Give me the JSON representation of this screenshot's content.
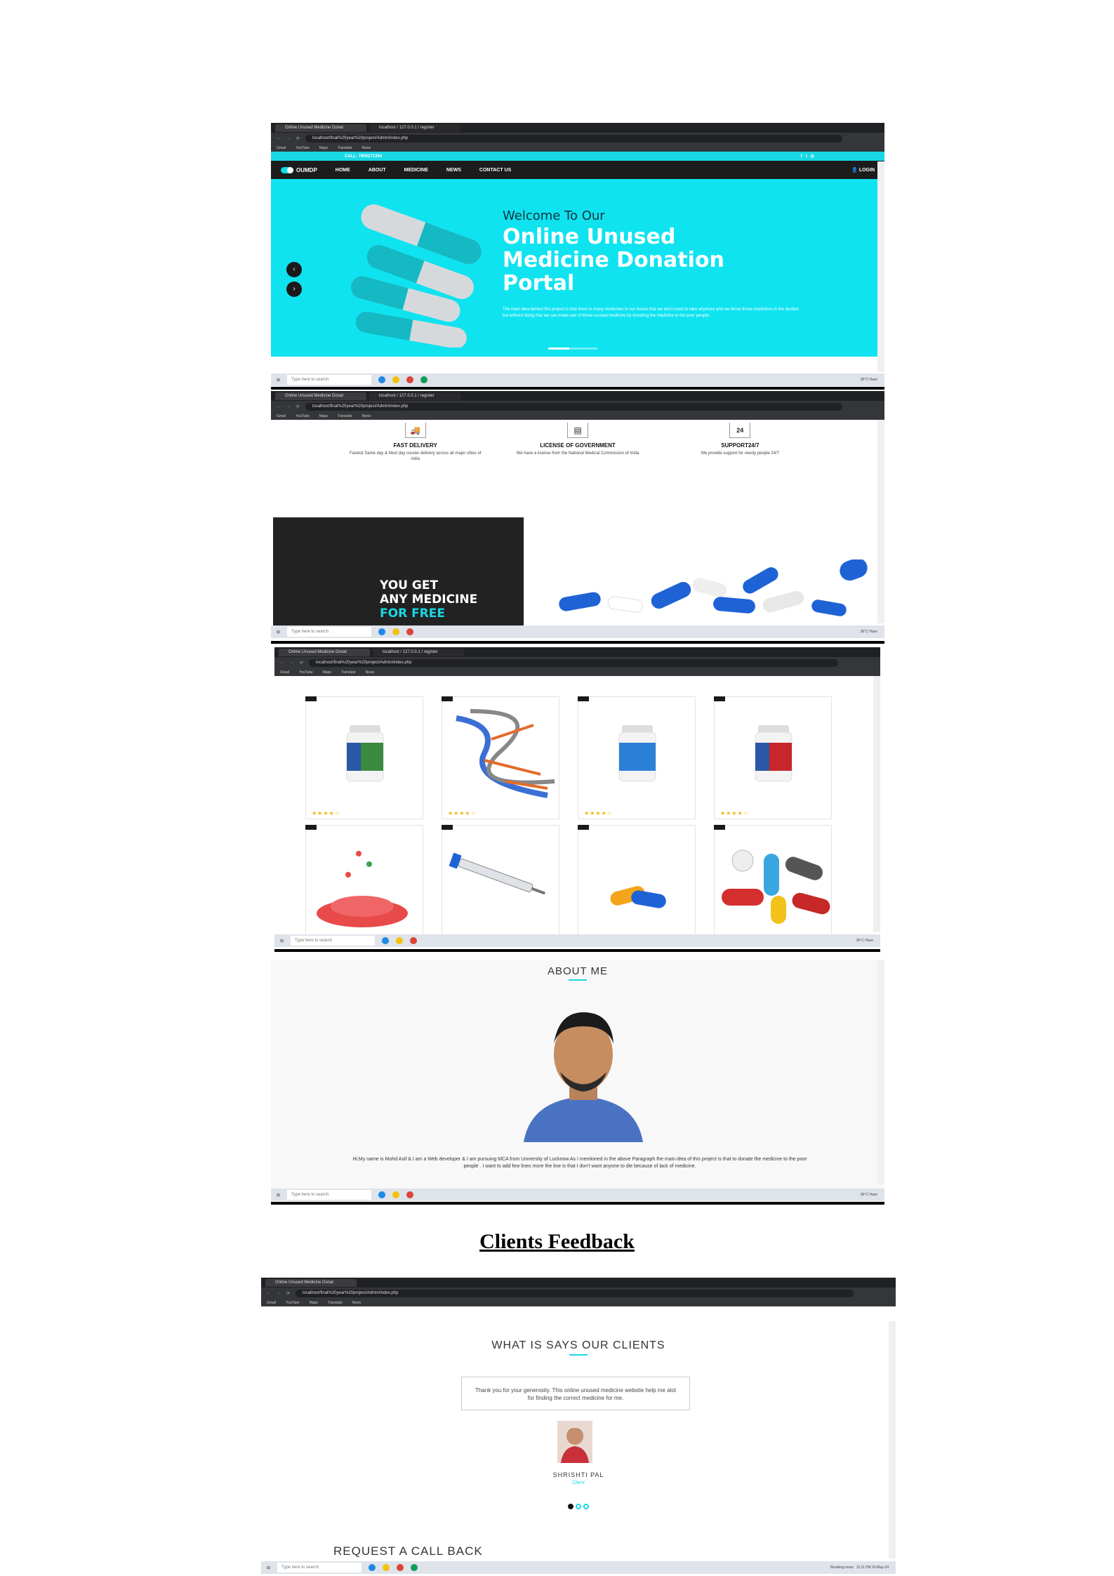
{
  "browser": {
    "tab_active": "Online Unused Medicine Donat",
    "tab_second": "localhost / 127.0.0.1 / register",
    "url": "localhost/final%20year%20project/Admin/index.php",
    "bookmarks": [
      "Gmail",
      "YouTube",
      "Maps",
      "Translate",
      "News"
    ]
  },
  "taskbar": {
    "search_placeholder": "Type here to search",
    "weather": "36°C Haze",
    "weather_last": "Breaking news",
    "time": "11:11 PM",
    "date": "15-May-24"
  },
  "site": {
    "call": "CALL: 7900271384",
    "brand": "OUMDP",
    "nav": [
      "HOME",
      "ABOUT",
      "MEDICINE",
      "NEWS",
      "CONTACT US"
    ],
    "login": "LOGIN",
    "hero_small": "Welcome To Our",
    "hero_big": "Online Unused Medicine Donation Portal",
    "hero_text": "The main idea behind this project is that there is many medicines in our house that we don't need to take anymore and we throw those medicines in the dustbin but without doing that we can make use of those unused medicine by donating the medicine to the poor people."
  },
  "features": [
    {
      "title": "FAST DELIVERY",
      "text": "Fastest Same day & Next day courier delivery across all major cities of india",
      "icon": "truck-icon"
    },
    {
      "title": "LICENSE OF GOVERNMENT",
      "text": "We have a license from the National Medical Commission of India",
      "icon": "license-icon"
    },
    {
      "title": "SUPPORT24/7",
      "text": "We provide support for needy people 24/7",
      "icon": "24-hours-icon"
    }
  ],
  "promo": {
    "line1": "YOU GET",
    "line2": "ANY MEDICINE",
    "line3": "FOR FREE"
  },
  "products": {
    "stars": "★★★★☆",
    "items": [
      "green-bottle",
      "dna",
      "blue-bottle",
      "red-bottle",
      "pills-pile",
      "syringe",
      "capsules",
      "assorted-pills"
    ]
  },
  "about": {
    "title": "ABOUT ME",
    "text": "Hi,My name is Mohd Asif & I am a Web developer & I am pursuing MCA from University of Lucknow.As I mentioned in the above Paragraph the main idea of this project is that to donate the medicine to the poor people . I want to add few lines more the line is that I don't want anyone to die because of lack of medicine."
  },
  "heading": "Clients Feedback",
  "clients": {
    "title": "WHAT IS SAYS OUR CLIENTS",
    "quote": "Thank you for your generosity. This online unused medicine website help me alot for finding the correct medicine for me.",
    "name": "SHRISHTI PAL",
    "role": "Client",
    "callback": "REQUEST A CALL BACK"
  },
  "colors": {
    "accent": "#18d8e5",
    "dark": "#1c1c1c"
  }
}
